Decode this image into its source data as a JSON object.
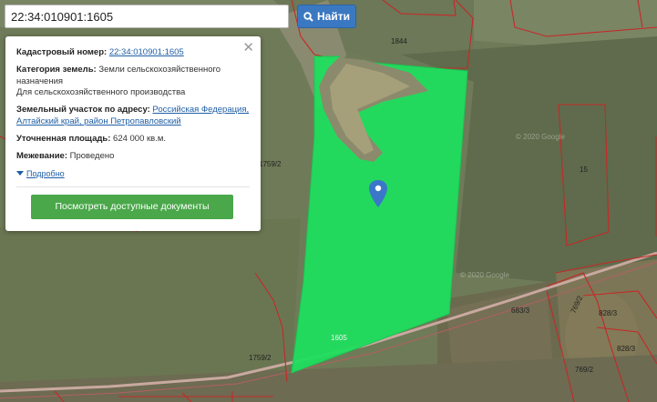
{
  "search": {
    "value": "22:34:010901:1605",
    "button_label": "Найти",
    "button_icon": "search-icon"
  },
  "popup": {
    "close_icon": "close-icon",
    "cadastral_label": "Кадастровый номер:",
    "cadastral_value": "22:34:010901:1605",
    "category_label": "Категория земель:",
    "category_value": "Земли сельскохозяйственного назначения",
    "usage_value": "Для сельскохозяйственного производства",
    "address_label": "Земельный участок по адресу:",
    "address_value": "Российская Федерация, Алтайский край, район Петропавловский",
    "area_label": "Уточненная площадь:",
    "area_value": "624 000 кв.м.",
    "survey_label": "Межевание:",
    "survey_value": "Проведено",
    "more_label": "Подробно",
    "docs_button_label": "Посмотреть доступные документы"
  },
  "map": {
    "plot_labels": [
      "1844",
      "1759/2",
      "15",
      "1759/2",
      "683/3",
      "769/2",
      "828/3",
      "828/3",
      "769/2",
      "1605"
    ],
    "copyright_1": "© 2020 Google",
    "copyright_2": "© 2020 Google",
    "marker_icon": "map-marker-icon",
    "colors": {
      "selected_plot": "#1fde5e",
      "boundary": "#c62828",
      "button": "#3b78c2",
      "docs_button": "#4aa84a"
    }
  }
}
